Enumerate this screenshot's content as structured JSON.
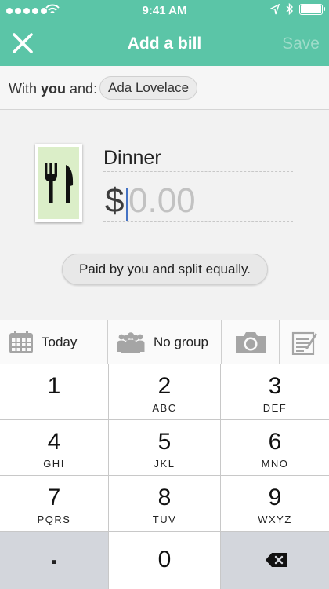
{
  "status_bar": {
    "time": "9:41 AM"
  },
  "nav": {
    "title": "Add a bill",
    "save_label": "Save",
    "close_icon": "close-icon"
  },
  "participants": {
    "label_prefix": "With ",
    "label_bold": "you",
    "label_suffix": " and:",
    "people": [
      "Ada Lovelace"
    ]
  },
  "bill": {
    "category_icon": "fork-knife-icon",
    "description": "Dinner",
    "currency_symbol": "$",
    "amount_placeholder": "0.00",
    "split_text": "Paid by you and split equally."
  },
  "toolbar": {
    "date_label": "Today",
    "group_label": "No group",
    "camera_icon": "camera-icon",
    "notes_icon": "notes-icon"
  },
  "keypad": {
    "keys": [
      {
        "digit": "1",
        "letters": ""
      },
      {
        "digit": "2",
        "letters": "ABC"
      },
      {
        "digit": "3",
        "letters": "DEF"
      },
      {
        "digit": "4",
        "letters": "GHI"
      },
      {
        "digit": "5",
        "letters": "JKL"
      },
      {
        "digit": "6",
        "letters": "MNO"
      },
      {
        "digit": "7",
        "letters": "PQRS"
      },
      {
        "digit": "8",
        "letters": "TUV"
      },
      {
        "digit": "9",
        "letters": "WXYZ"
      }
    ],
    "decimal": ".",
    "zero": "0",
    "backspace_icon": "backspace-icon"
  },
  "colors": {
    "brand": "#5bc5a7",
    "category_bg": "#dbeec8",
    "cursor": "#4472c4"
  }
}
